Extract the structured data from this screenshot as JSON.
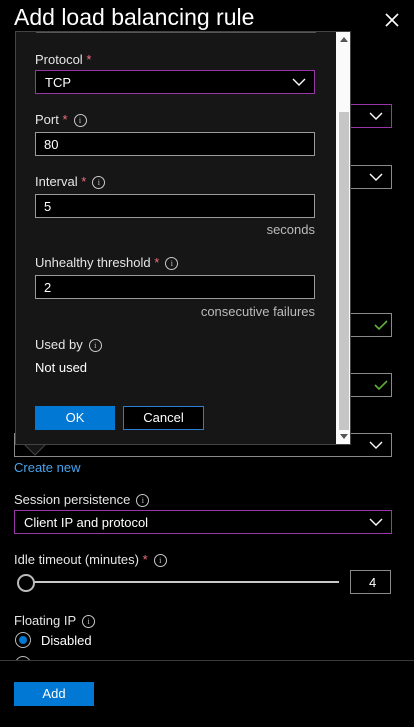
{
  "header": {
    "title": "Add load balancing rule",
    "close_icon": "close-icon"
  },
  "health_probe_popup": {
    "protocol": {
      "label": "Protocol",
      "required": "*",
      "value": "TCP"
    },
    "port": {
      "label": "Port",
      "required": "*",
      "info": "i",
      "value": "80"
    },
    "interval": {
      "label": "Interval",
      "required": "*",
      "info": "i",
      "value": "5",
      "unit": "seconds"
    },
    "unhealthy_threshold": {
      "label": "Unhealthy threshold",
      "required": "*",
      "info": "i",
      "value": "2",
      "unit": "consecutive failures"
    },
    "used_by": {
      "label": "Used by",
      "info": "i",
      "value": "Not used"
    },
    "ok_label": "OK",
    "cancel_label": "Cancel"
  },
  "create_new_link": "Create new",
  "session_persistence": {
    "label": "Session persistence",
    "info": "i",
    "value": "Client IP and protocol"
  },
  "idle_timeout": {
    "label": "Idle timeout (minutes)",
    "required": "*",
    "info": "i",
    "value": "4"
  },
  "floating_ip": {
    "label": "Floating IP",
    "info": "i",
    "options": [
      "Disabled"
    ],
    "selected": "Disabled"
  },
  "footer": {
    "add_label": "Add"
  },
  "colors": {
    "accent": "#0078d4",
    "focus_border": "#9a37a8",
    "required": "#f1707b",
    "link": "#4aa3ee",
    "valid": "#5fb03b"
  }
}
